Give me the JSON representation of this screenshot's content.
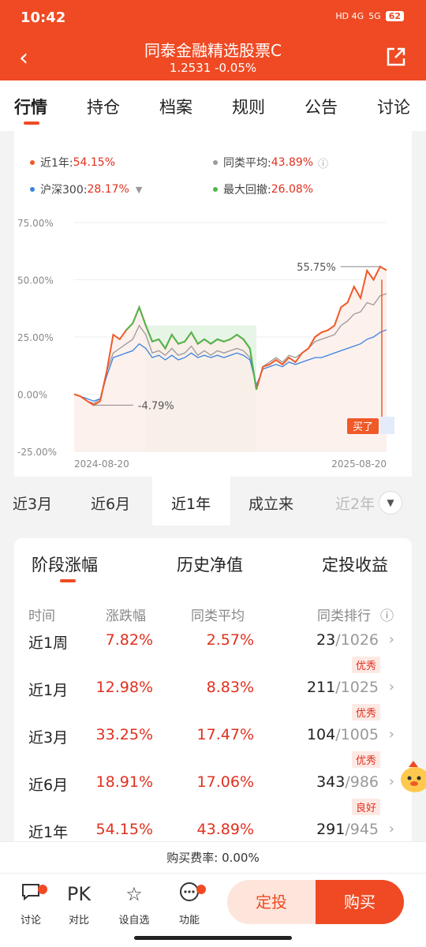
{
  "status": {
    "time": "10:42",
    "net1": "HD 4G",
    "net2": "5G",
    "battery": "62"
  },
  "header": {
    "title": "同泰金融精选股票C",
    "subtitle": "1.2531 -0.05%"
  },
  "tabs": [
    "行情",
    "持仓",
    "档案",
    "规则",
    "公告",
    "讨论"
  ],
  "legend": {
    "fund": {
      "label": "近1年:",
      "value": "54.15%"
    },
    "avg": {
      "label": "同类平均:",
      "value": "43.89%"
    },
    "hs300": {
      "label": "沪深300:",
      "value": "28.17%"
    },
    "mdd": {
      "label": "最大回撤:",
      "value": "26.08%"
    }
  },
  "chart_data": {
    "type": "line",
    "x_start": "2024-08-20",
    "x_end": "2025-08-20",
    "ylim": [
      -25,
      75
    ],
    "yticks": [
      "75.00%",
      "50.00%",
      "25.00%",
      "0.00%",
      "-25.00%"
    ],
    "xticks": [
      "2024-08-20",
      "2025-08-20"
    ],
    "annotations": {
      "max": "55.75%",
      "min": "-4.79%",
      "buy": "买了"
    },
    "series": [
      {
        "name": "近1年",
        "color": "#ef5a28",
        "values": [
          0,
          -1,
          -3,
          -4.8,
          -3,
          10,
          26,
          24,
          28,
          31,
          38,
          30,
          23,
          24,
          20,
          26,
          22,
          23,
          27,
          22,
          24,
          22,
          24,
          23,
          24,
          26,
          24,
          20,
          2,
          12,
          13,
          15,
          13,
          16,
          14,
          18,
          20,
          25,
          27,
          28,
          30,
          38,
          40,
          47,
          42,
          54,
          50,
          55.75,
          54.15
        ]
      },
      {
        "name": "同类平均",
        "color": "#9a9a9a",
        "values": [
          0,
          -1,
          -3,
          -4,
          -2,
          10,
          18,
          20,
          22,
          24,
          30,
          26,
          18,
          19,
          17,
          20,
          17,
          18,
          21,
          17,
          19,
          17,
          19,
          18,
          19,
          20,
          19,
          16,
          3,
          12,
          14,
          16,
          14,
          17,
          16,
          18,
          20,
          23,
          24,
          25,
          26,
          30,
          32,
          35,
          36,
          40,
          39,
          43,
          43.89
        ]
      },
      {
        "name": "沪深300",
        "color": "#3b82e0",
        "values": [
          0,
          -1,
          -2,
          -3,
          -2,
          8,
          16,
          17,
          18,
          19,
          22,
          20,
          16,
          17,
          15,
          17,
          15,
          16,
          18,
          16,
          17,
          16,
          17,
          16,
          17,
          18,
          17,
          15,
          4,
          11,
          12,
          13,
          12,
          14,
          13,
          14,
          15,
          16,
          16,
          17,
          18,
          19,
          20,
          21,
          22,
          24,
          25,
          27,
          28.17
        ]
      }
    ]
  },
  "periods": [
    "近3月",
    "近6月",
    "近1年",
    "成立来",
    "近2年"
  ],
  "section_tabs": [
    "阶段涨幅",
    "历史净值",
    "定投收益"
  ],
  "table": {
    "headers": [
      "时间",
      "涨跌幅",
      "同类平均",
      "同类排行"
    ],
    "rows": [
      {
        "period": "近1周",
        "change": "7.82%",
        "avg": "2.57%",
        "rank": "23",
        "total": "/1026",
        "tag": "优秀"
      },
      {
        "period": "近1月",
        "change": "12.98%",
        "avg": "8.83%",
        "rank": "211",
        "total": "/1025",
        "tag": "优秀"
      },
      {
        "period": "近3月",
        "change": "33.25%",
        "avg": "17.47%",
        "rank": "104",
        "total": "/1005",
        "tag": "优秀"
      },
      {
        "period": "近6月",
        "change": "18.91%",
        "avg": "17.06%",
        "rank": "343",
        "total": "/986",
        "tag": "良好"
      },
      {
        "period": "近1年",
        "change": "54.15%",
        "avg": "43.89%",
        "rank": "291",
        "total": "/945",
        "tag": ""
      }
    ]
  },
  "fee": "购买费率: 0.00%",
  "bottom": {
    "discuss": "讨论",
    "pk": "PK",
    "compare": "对比",
    "watch": "设自选",
    "func": "功能",
    "dingtou": "定投",
    "buy": "购买"
  }
}
